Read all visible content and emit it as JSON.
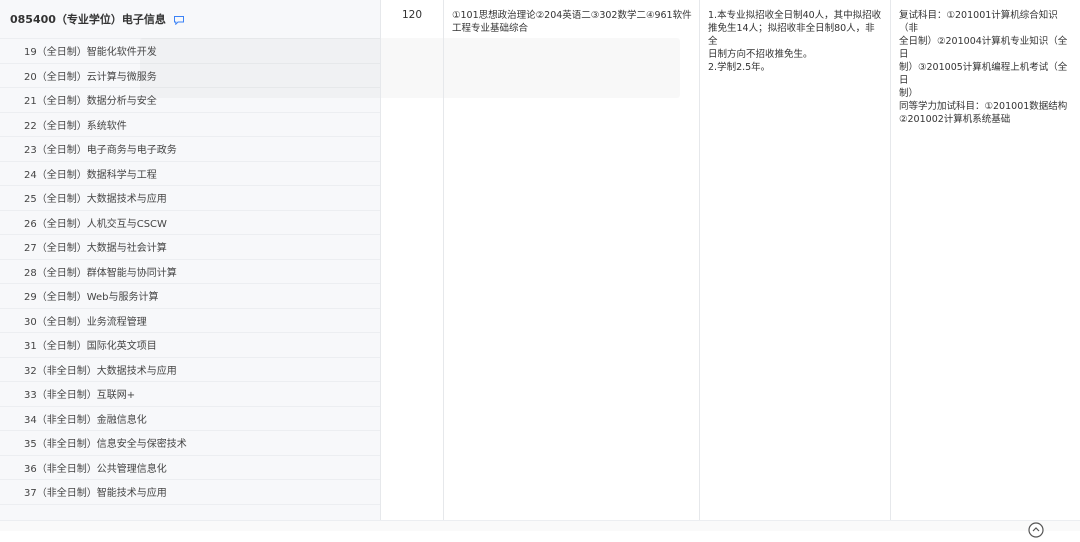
{
  "major": {
    "code_name": "085400（专业学位）电子信息",
    "icon": "comment-icon"
  },
  "directions": [
    "19（全日制）智能化软件开发",
    "20（全日制）云计算与微服务",
    "21（全日制）数据分析与安全",
    "22（全日制）系统软件",
    "23（全日制）电子商务与电子政务",
    "24（全日制）数据科学与工程",
    "25（全日制）大数据技术与应用",
    "26（全日制）人机交互与CSCW",
    "27（全日制）大数据与社会计算",
    "28（全日制）群体智能与协同计算",
    "29（全日制）Web与服务计算",
    "30（全日制）业务流程管理",
    "31（全日制）国际化英文项目",
    "32（非全日制）大数据技术与应用",
    "33（非全日制）互联网+",
    "34（非全日制）金融信息化",
    "35（非全日制）信息安全与保密技术",
    "36（非全日制）公共管理信息化",
    "37（非全日制）智能技术与应用"
  ],
  "details": {
    "count": "120",
    "exam_lines": [
      "①101思想政治理论②204英语二③302数学二④961软件",
      "工程专业基础综合"
    ],
    "note_lines": [
      "1.本专业拟招收全日制40人，其中拟招收",
      "推免生14人；拟招收非全日制80人，非全",
      "日制方向不招收推免生。",
      "2.学制2.5年。"
    ],
    "retest_lines": [
      "复试科目：①201001计算机综合知识（非",
      "全日制）②201004计算机专业知识（全日",
      "制）③201005计算机编程上机考试（全日",
      "制）",
      "同等学力加试科目：①201001数据结构",
      "②201002计算机系统基础"
    ]
  },
  "footer": {
    "icon": "scroll-up-icon"
  }
}
